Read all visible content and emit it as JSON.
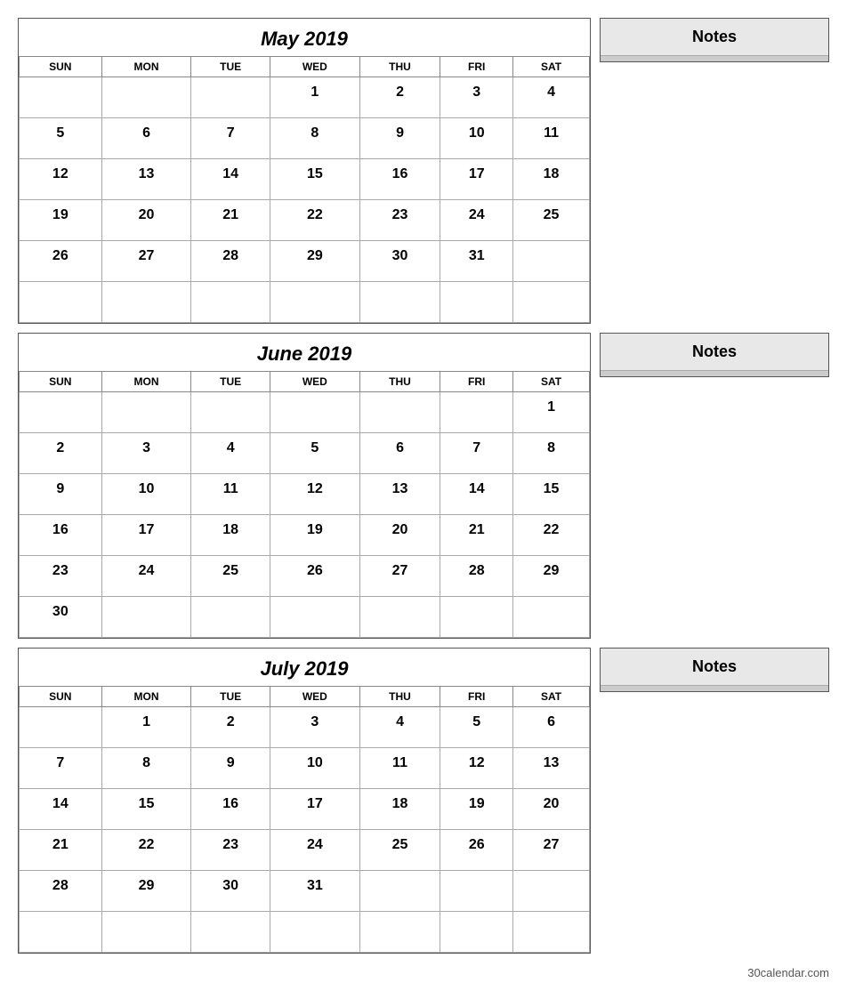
{
  "months": [
    {
      "title": "May 2019",
      "days_header": [
        "SUN",
        "MON",
        "TUE",
        "WED",
        "THU",
        "FRI",
        "SAT"
      ],
      "weeks": [
        [
          "",
          "",
          "",
          "1",
          "2",
          "3",
          "4"
        ],
        [
          "5",
          "6",
          "7",
          "8",
          "9",
          "10",
          "11"
        ],
        [
          "12",
          "13",
          "14",
          "15",
          "16",
          "17",
          "18"
        ],
        [
          "19",
          "20",
          "21",
          "22",
          "23",
          "24",
          "25"
        ],
        [
          "26",
          "27",
          "28",
          "29",
          "30",
          "31",
          ""
        ],
        [
          "",
          "",
          "",
          "",
          "",
          "",
          ""
        ]
      ],
      "notes_label": "Notes",
      "notes_lines": 6
    },
    {
      "title": "June 2019",
      "days_header": [
        "SUN",
        "MON",
        "TUE",
        "WED",
        "THU",
        "FRI",
        "SAT"
      ],
      "weeks": [
        [
          "",
          "",
          "",
          "",
          "",
          "",
          "1"
        ],
        [
          "2",
          "3",
          "4",
          "5",
          "6",
          "7",
          "8"
        ],
        [
          "9",
          "10",
          "11",
          "12",
          "13",
          "14",
          "15"
        ],
        [
          "16",
          "17",
          "18",
          "19",
          "20",
          "21",
          "22"
        ],
        [
          "23",
          "24",
          "25",
          "26",
          "27",
          "28",
          "29"
        ],
        [
          "30",
          "",
          "",
          "",
          "",
          "",
          ""
        ]
      ],
      "notes_label": "Notes",
      "notes_lines": 6
    },
    {
      "title": "July 2019",
      "days_header": [
        "SUN",
        "MON",
        "TUE",
        "WED",
        "THU",
        "FRI",
        "SAT"
      ],
      "weeks": [
        [
          "",
          "1",
          "2",
          "3",
          "4",
          "5",
          "6"
        ],
        [
          "7",
          "8",
          "9",
          "10",
          "11",
          "12",
          "13"
        ],
        [
          "14",
          "15",
          "16",
          "17",
          "18",
          "19",
          "20"
        ],
        [
          "21",
          "22",
          "23",
          "24",
          "25",
          "26",
          "27"
        ],
        [
          "28",
          "29",
          "30",
          "31",
          "",
          "",
          ""
        ],
        [
          "",
          "",
          "",
          "",
          "",
          "",
          ""
        ]
      ],
      "notes_label": "Notes",
      "notes_lines": 6
    }
  ],
  "footer": {
    "text": "30calendar.com"
  }
}
